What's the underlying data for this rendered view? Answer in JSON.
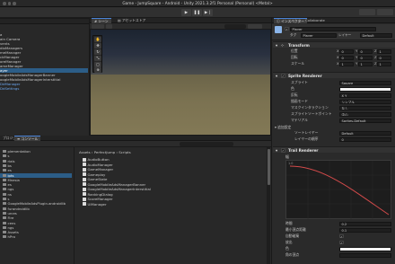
{
  "window": {
    "title": "Game - JumpSquare - Android - Unity 2021.3.2f1 Personal (Personal) <Metal>"
  },
  "scene_tabs": {
    "scene": "シーン",
    "asset_store": "アセットストア"
  },
  "hierarchy": {
    "items": [
      {
        "label": "a",
        "sel": false,
        "blue": false,
        "indent": 0
      },
      {
        "label": "ain Camera",
        "sel": false,
        "blue": false,
        "indent": 0
      },
      {
        "label": "vents",
        "sel": false,
        "blue": false,
        "indent": 0
      },
      {
        "label": "dioManagers",
        "sel": false,
        "blue": false,
        "indent": 0
      },
      {
        "label": "meManager",
        "sel": false,
        "blue": false,
        "indent": 0
      },
      {
        "label": "ckManager",
        "sel": false,
        "blue": false,
        "indent": 0
      },
      {
        "label": "oreManager",
        "sel": false,
        "blue": false,
        "indent": 0
      },
      {
        "label": "ameManager",
        "sel": false,
        "blue": false,
        "indent": 0
      },
      {
        "label": "ayer",
        "sel": true,
        "blue": false,
        "indent": 0
      },
      {
        "label": "oogleMobileAdsManagerBanner",
        "sel": false,
        "blue": false,
        "indent": 0
      },
      {
        "label": "oogleMobileAdsManagerInterstitial",
        "sel": false,
        "blue": false,
        "indent": 0
      },
      {
        "label": "DdManager",
        "sel": false,
        "blue": true,
        "indent": 0
      },
      {
        "label": "DdSettings",
        "sel": false,
        "blue": true,
        "indent": 0
      }
    ]
  },
  "console_tabs": {
    "project": "プロジェクト",
    "console": "コンソール"
  },
  "project": {
    "breadcrumb": [
      "Assets",
      "PerfectJump",
      "Scripts"
    ],
    "tree": [
      {
        "label": "plementation",
        "sel": false
      },
      {
        "label": "s",
        "sel": false
      },
      {
        "label": "rials",
        "sel": false
      },
      {
        "label": "bs",
        "sel": false
      },
      {
        "label": "es",
        "sel": false
      },
      {
        "label": "ipts",
        "sel": true
      },
      {
        "label": "Mnesia",
        "sel": false
      },
      {
        "label": "es",
        "sel": false
      },
      {
        "label": "ngs",
        "sel": false
      },
      {
        "label": "ns",
        "sel": false
      },
      {
        "label": "s",
        "sel": false
      },
      {
        "label": "GoogleMobileAdsPlugin.androidlib",
        "sel": false
      },
      {
        "label": "furandroidlib",
        "sel": false
      },
      {
        "label": "urces",
        "sel": false
      },
      {
        "label": "Fire",
        "sel": false
      },
      {
        "label": "cens",
        "sel": false
      },
      {
        "label": "ngs",
        "sel": false
      },
      {
        "label": "Assets",
        "sel": false
      },
      {
        "label": "hPro",
        "sel": false
      }
    ],
    "files": [
      "AudioButton",
      "AudioManager",
      "GameManager",
      "Gameplay",
      "GameState",
      "GoogleMobileAdsManagerBanner",
      "GoogleMobileAdsManagerInterstitial",
      "RankingDialog",
      "ScoreManager",
      "UIManager"
    ]
  },
  "inspector": {
    "tabs": {
      "inspector": "インスペクター",
      "collaborate": "Collaborate"
    },
    "object_name": "Player",
    "tag_label": "タグ",
    "tag_value": "Player",
    "layer_label": "レイヤー",
    "layer_value": "Default",
    "transform": {
      "header": "Transform",
      "rows": [
        {
          "label": "位置",
          "x": "0",
          "y": "0",
          "z": "1"
        },
        {
          "label": "回転",
          "x": "0",
          "y": "0",
          "z": "0"
        },
        {
          "label": "スケール",
          "x": "1",
          "y": "1",
          "z": "1"
        }
      ]
    },
    "sprite_renderer": {
      "header": "Sprite Renderer",
      "rows": [
        {
          "label": "スプライト",
          "value": "Square"
        },
        {
          "label": "色",
          "value": ""
        },
        {
          "label": "反転",
          "value": "X  Y"
        },
        {
          "label": "描画モード",
          "value": "シンプル"
        },
        {
          "label": "マスクインタラクション",
          "value": "なし"
        },
        {
          "label": "スプライトソートポイント",
          "value": "中心"
        },
        {
          "label": "マテリアル",
          "value": "Sprites-Default"
        }
      ],
      "extra_header": "追加設定",
      "extra_rows": [
        {
          "label": "ソートレイヤー",
          "value": "Default"
        },
        {
          "label": "レイヤーの順序",
          "value": "0"
        }
      ]
    },
    "trail_renderer": {
      "header": "Trail Renderer",
      "width_label": "幅",
      "curve_value": "1.0",
      "rows": [
        {
          "label": "時間",
          "value": "0.2"
        },
        {
          "label": "最小頂点距離",
          "value": "0.1"
        },
        {
          "label": "自動破棄",
          "value": ""
        },
        {
          "label": "放出",
          "value": ""
        },
        {
          "label": "色",
          "value": ""
        },
        {
          "label": "角の頂点",
          "value": ""
        }
      ]
    }
  },
  "colors": {
    "selection": "#2c5d87",
    "accent": "#4a84d8"
  }
}
